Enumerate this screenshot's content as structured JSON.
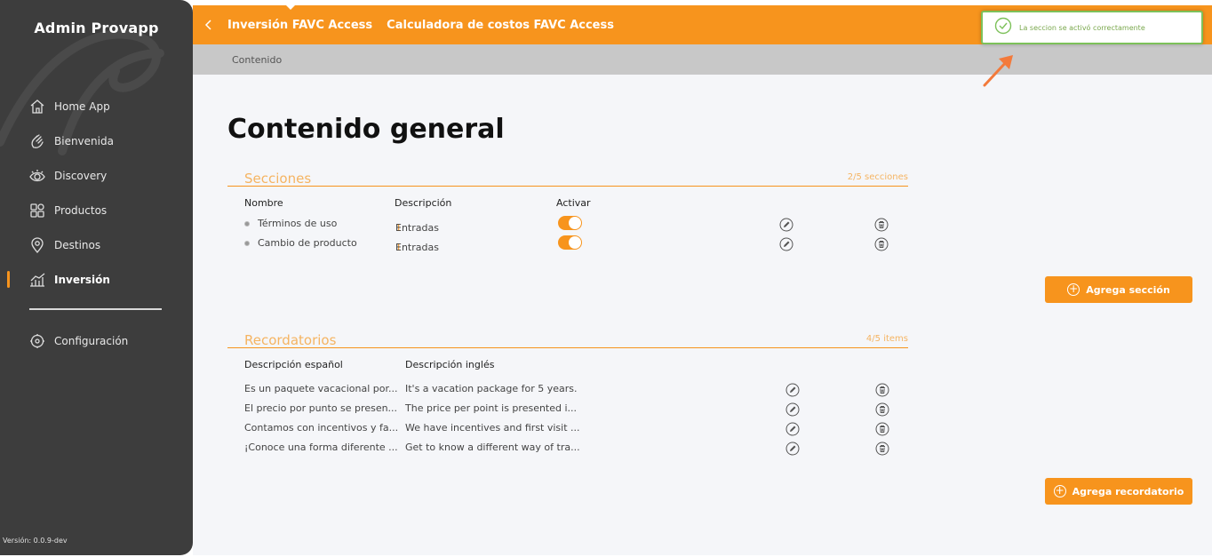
{
  "sidebar": {
    "brand": "Admin Provapp",
    "items": [
      {
        "label": "Home App",
        "icon": "home-icon"
      },
      {
        "label": "Bienvenida",
        "icon": "hand-wave-icon"
      },
      {
        "label": "Discovery",
        "icon": "eye-icon"
      },
      {
        "label": "Productos",
        "icon": "grid-icon"
      },
      {
        "label": "Destinos",
        "icon": "location-pin-icon"
      },
      {
        "label": "Inversión",
        "icon": "chart-bars-icon",
        "active": true
      }
    ],
    "settings": {
      "label": "Configuración",
      "icon": "settings-icon"
    },
    "version": "Versión: 0.0.9-dev"
  },
  "header": {
    "crumb_1": "Inversión FAVC Access",
    "crumb_2": "Calculadora de costos FAVC Access",
    "subnav": "Contenido"
  },
  "toast": {
    "message": "La seccion se activó correctamente",
    "color": "#7dc15a"
  },
  "main": {
    "title": "Contenido general",
    "secciones": {
      "title": "Secciones",
      "count": "2/5 secciones",
      "columns": {
        "name": "Nombre",
        "desc": "Descripción",
        "active": "Activar"
      },
      "rows": [
        {
          "name": "Términos de uso",
          "num": "1",
          "entries": " Entradas",
          "active": true
        },
        {
          "name": "Cambio de producto",
          "num": "1",
          "entries": " Entradas",
          "active": true
        }
      ],
      "add_label": "Agrega sección"
    },
    "recordatorios": {
      "title": "Recordatorios",
      "count": "4/5 items",
      "columns": {
        "es": "Descripción español",
        "en": "Descripción inglés"
      },
      "rows": [
        {
          "es": "Es un paquete vacacional por...",
          "en": "It's a vacation package for 5 years."
        },
        {
          "es": "El precio por punto se presen...",
          "en": "The price per point is presented i..."
        },
        {
          "es": "Contamos con incentivos y fa...",
          "en": "We have incentives and first visit ..."
        },
        {
          "es": "¡Conoce una forma diferente ...",
          "en": "Get to know a different way of tra..."
        }
      ],
      "add_label": "Agrega recordatorio"
    }
  },
  "colors": {
    "accent": "#f7941d",
    "sidebar": "#3d3d3d",
    "success": "#7dc15a"
  }
}
